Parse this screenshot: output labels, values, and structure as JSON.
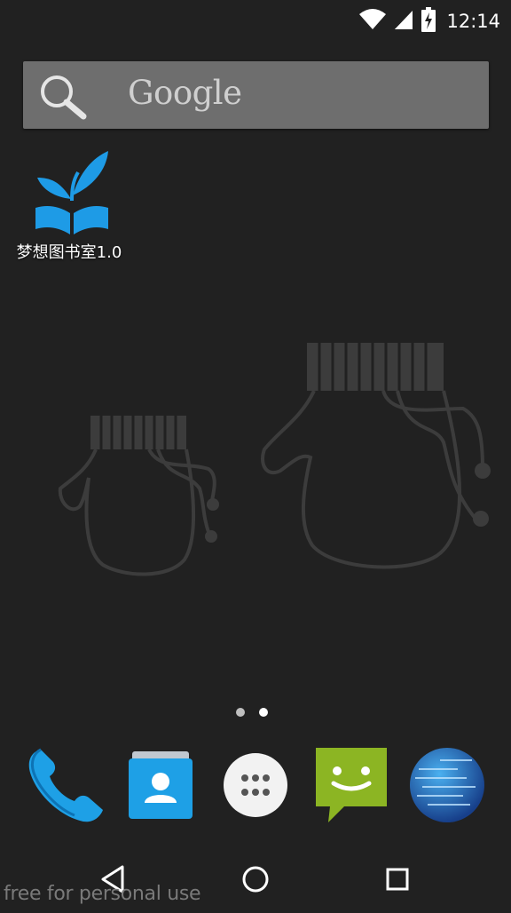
{
  "status_bar": {
    "time": "12:14",
    "icons": [
      "wifi-icon",
      "cell-signal-icon",
      "battery-charging-icon"
    ]
  },
  "search_widget": {
    "logo_text": "Google",
    "icon": "search-icon"
  },
  "home_apps": [
    {
      "label": "梦想图书室1.0",
      "icon": "sprout-book-icon",
      "color": "#1e9be6"
    }
  ],
  "page_indicator": {
    "pages": 2,
    "current": 2
  },
  "dock": [
    {
      "name": "phone",
      "icon": "phone-icon",
      "color": "#1ea0e6"
    },
    {
      "name": "contacts",
      "icon": "contacts-icon",
      "color": "#1ea0e6"
    },
    {
      "name": "app-drawer",
      "icon": "app-drawer-icon",
      "color": "#f2f2f2"
    },
    {
      "name": "messaging",
      "icon": "messaging-icon",
      "color": "#8cb523"
    },
    {
      "name": "browser",
      "icon": "globe-icon",
      "color": "#2a6fc9"
    }
  ],
  "nav_bar": {
    "back": "back-icon",
    "home": "home-icon",
    "recents": "recents-icon"
  },
  "watermark_text": "free for personal use"
}
